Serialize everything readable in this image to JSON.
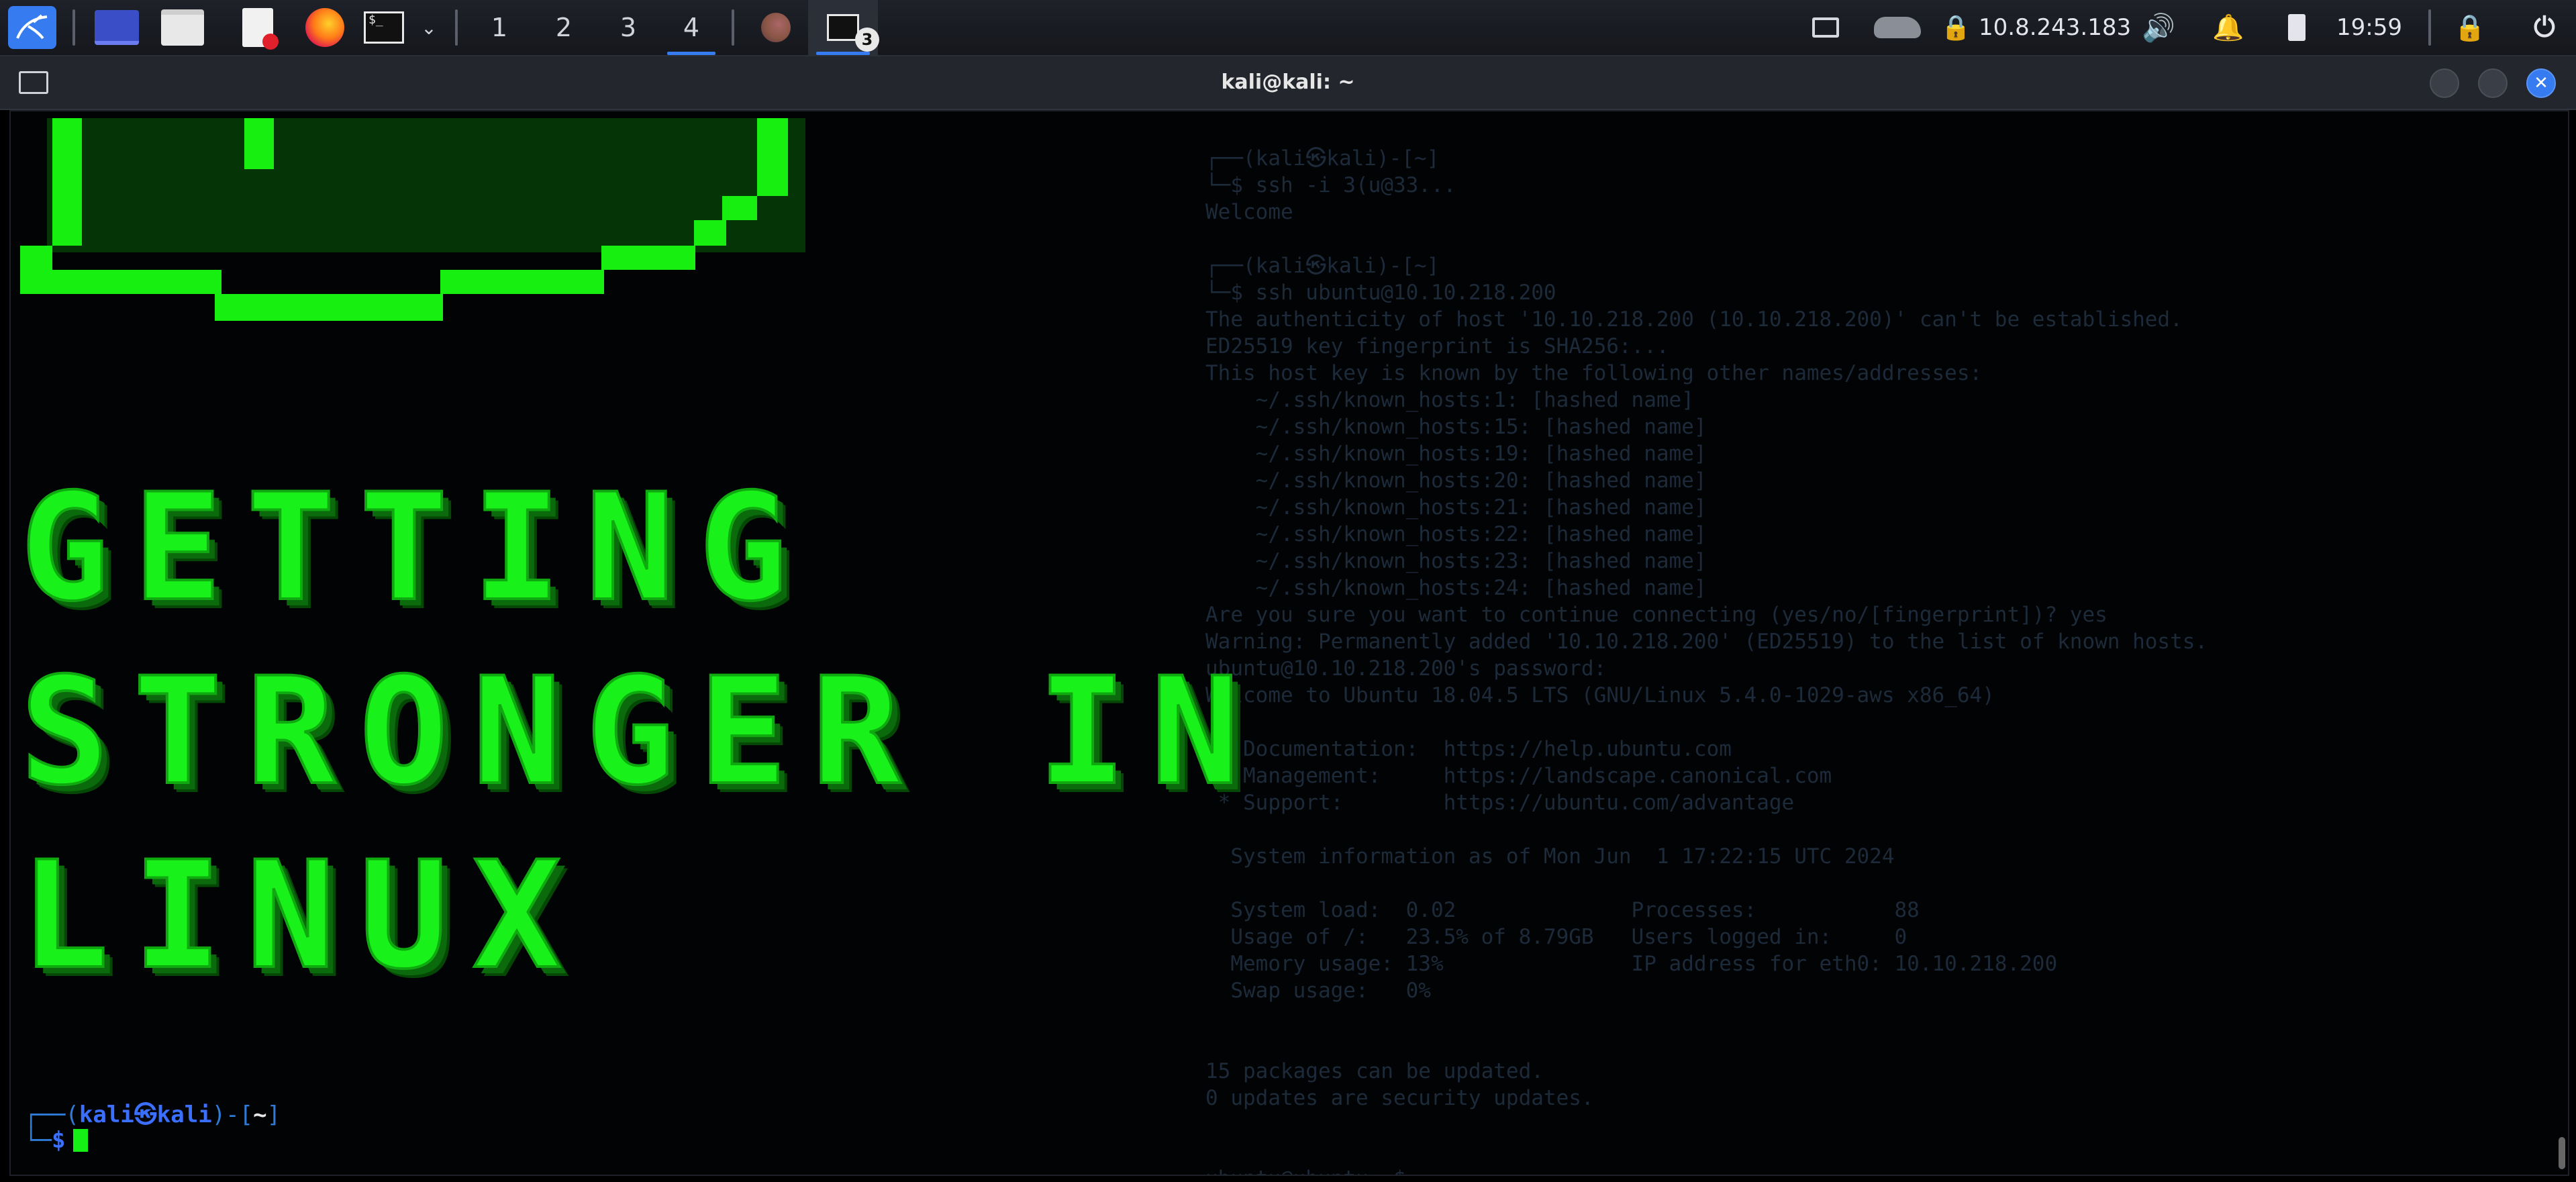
{
  "panel": {
    "workspaces": [
      "1",
      "2",
      "3",
      "4"
    ],
    "active_workspace": "4",
    "task_badge": "3",
    "network_ip": "10.8.243.183",
    "clock": "19:59",
    "icons": [
      "kali-menu-icon",
      "desktop-icon",
      "file-manager-icon",
      "text-editor-icon",
      "firefox-icon",
      "terminal-icon",
      "chevron-down-icon",
      "firefox-task-icon",
      "terminal-task-icon",
      "display-icon",
      "cloud-icon",
      "vpn-lock-icon",
      "volume-icon",
      "notification-bell-icon",
      "battery-icon",
      "lock-screen-icon",
      "power-icon"
    ]
  },
  "window": {
    "title": "kali@kali: ~"
  },
  "terminal": {
    "banner": [
      "GETTING",
      "STRONGER IN",
      "LINUX"
    ],
    "prompt": {
      "user": "kali",
      "host": "kali",
      "path": "~",
      "symbol": "$"
    },
    "ghost_lines": [
      "┌──(kali㉿kali)-[~]",
      "└─$ ssh -i 3(u@33...",
      "Welcome",
      "",
      "┌──(kali㉿kali)-[~]",
      "└─$ ssh ubuntu@10.10.218.200",
      "The authenticity of host '10.10.218.200 (10.10.218.200)' can't be established.",
      "ED25519 key fingerprint is SHA256:...",
      "This host key is known by the following other names/addresses:",
      "    ~/.ssh/known_hosts:1: [hashed name]",
      "    ~/.ssh/known_hosts:15: [hashed name]",
      "    ~/.ssh/known_hosts:19: [hashed name]",
      "    ~/.ssh/known_hosts:20: [hashed name]",
      "    ~/.ssh/known_hosts:21: [hashed name]",
      "    ~/.ssh/known_hosts:22: [hashed name]",
      "    ~/.ssh/known_hosts:23: [hashed name]",
      "    ~/.ssh/known_hosts:24: [hashed name]",
      "Are you sure you want to continue connecting (yes/no/[fingerprint])? yes",
      "Warning: Permanently added '10.10.218.200' (ED25519) to the list of known hosts.",
      "ubuntu@10.10.218.200's password:",
      "Welcome to Ubuntu 18.04.5 LTS (GNU/Linux 5.4.0-1029-aws x86_64)",
      "",
      " * Documentation:  https://help.ubuntu.com",
      " * Management:     https://landscape.canonical.com",
      " * Support:        https://ubuntu.com/advantage",
      "",
      "  System information as of Mon Jun  1 17:22:15 UTC 2024",
      "",
      "  System load:  0.02              Processes:           88",
      "  Usage of /:   23.5% of 8.79GB   Users logged in:     0",
      "  Memory usage: 13%               IP address for eth0: 10.10.218.200",
      "  Swap usage:   0%",
      "",
      "",
      "15 packages can be updated.",
      "0 updates are security updates.",
      "",
      "",
      "ubuntu@ubuntu:~$"
    ]
  }
}
